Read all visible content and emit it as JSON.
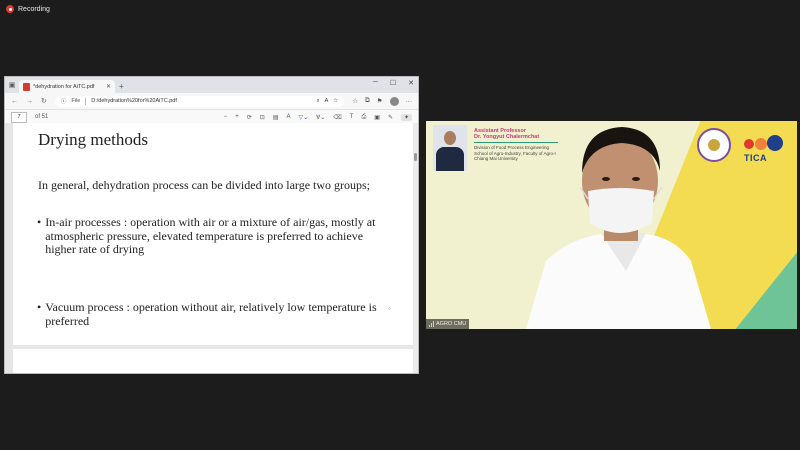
{
  "recording": {
    "label": "Recording"
  },
  "browser": {
    "tab_title": "*dehydration for AiTC.pdf",
    "address": {
      "scheme_label": "File",
      "url": "D:/dehydration%20for%20AiTC.pdf"
    },
    "pdf_toolbar": {
      "page_number": "7",
      "page_total": "of 51"
    }
  },
  "slide": {
    "title": "Drying methods",
    "intro": "In general, dehydration process can be divided into large two groups;",
    "bullets": [
      "In-air processes : operation with air or a mixture of air/gas, mostly at atmospheric pressure, elevated temperature is preferred to achieve higher rate of drying",
      "Vacuum process : operation without air, relatively low temperature is preferred"
    ]
  },
  "video": {
    "speaker": {
      "role": "Assistant Professor",
      "name": "Dr. Yongyut Chalermchat",
      "affiliation_lines": [
        "Division of Food Process Engineering",
        "School of Agro-Industry, Faculty of Agro-I",
        "Chiang Mai University"
      ]
    },
    "brand": "TICA",
    "participant_name": "AGRO CMU",
    "colors": {
      "yellow": "#f3dc52",
      "pink": "#f1b3c8",
      "green": "#6fc497",
      "tica_blue": "#1f3f8a",
      "tica_red": "#e2392c"
    }
  }
}
